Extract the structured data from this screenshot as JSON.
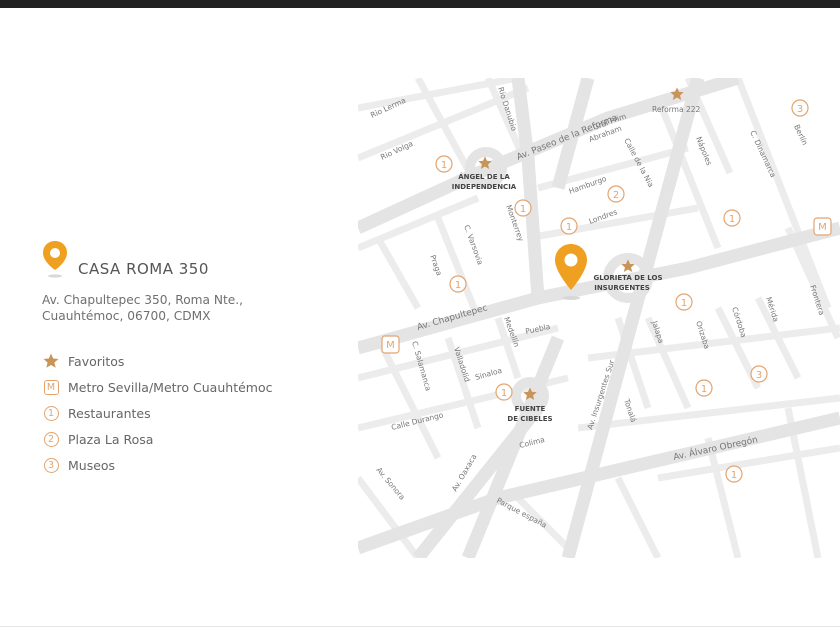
{
  "legend": {
    "title": "CASA ROMA 350",
    "address_line1": "Av. Chapultepec 350, Roma Nte.,",
    "address_line2": "Cuauhtémoc, 06700, CDMX",
    "items": [
      {
        "icon": "star-icon",
        "label": "Favoritos"
      },
      {
        "icon": "metro-icon",
        "symbol": "M",
        "label": "Metro Sevilla/Metro Cuauhtémoc"
      },
      {
        "icon": "number-1-icon",
        "symbol": "1",
        "label": "Restaurantes"
      },
      {
        "icon": "number-2-icon",
        "symbol": "2",
        "label": "Plaza La Rosa"
      },
      {
        "icon": "number-3-icon",
        "symbol": "3",
        "label": "Museos"
      }
    ]
  },
  "map": {
    "streets": {
      "rio_lerma": "Rio Lerma",
      "rio_volga": "Rio Volga",
      "rio_danubio": "Rio Danubio",
      "reforma": "Av. Paseo de la Reforma",
      "reforma222": "Reforma 222",
      "gral_prim": "Gral Prim",
      "abraham": "Abraham",
      "calle_liverpool": "Calle de la Nia",
      "hamburgo": "Hamburgo",
      "londres": "Londres",
      "napoles": "Nápoles",
      "dinamarca": "C. Dinamarca",
      "berlin": "Berlín",
      "monterrey": "Monterrey",
      "varsovia": "C. Varsovia",
      "praga": "Praga",
      "chapultepec": "Av. Chapultepec",
      "puebla": "Puebla",
      "medellin": "Medellín",
      "salamanca": "C. Salamanca",
      "valladolid": "Valladolid",
      "sinaloa": "Sinaloa",
      "durango": "Calle Durango",
      "oaxaca": "Av. Oaxaca",
      "sonora": "Av. Sonora",
      "colima": "Colima",
      "insurgentes": "Av. Insurgentes Sur",
      "tonala": "Tonalá",
      "jalapa": "Jalapa",
      "orizaba": "Orizaba",
      "cordoba": "Córdoba",
      "merida": "Mérida",
      "frontera": "Frontera",
      "obregon": "Av. Álvaro Obregón",
      "parque_espana": "Parque españa"
    },
    "landmarks": {
      "angel_1": "ÁNGEL DE LA",
      "angel_2": "INDEPENDENCIA",
      "glorieta_1": "GLORIETA DE LOS",
      "glorieta_2": "INSURGENTES",
      "cibeles_1": "FUENTE",
      "cibeles_2": "DE CIBELES"
    },
    "markers": {
      "one": "1",
      "two": "2",
      "three": "3",
      "metro": "M"
    }
  },
  "colors": {
    "accent": "#e3a46f",
    "pin": "#f0a020",
    "star": "#c9945a",
    "road": "#e4e4e4"
  }
}
